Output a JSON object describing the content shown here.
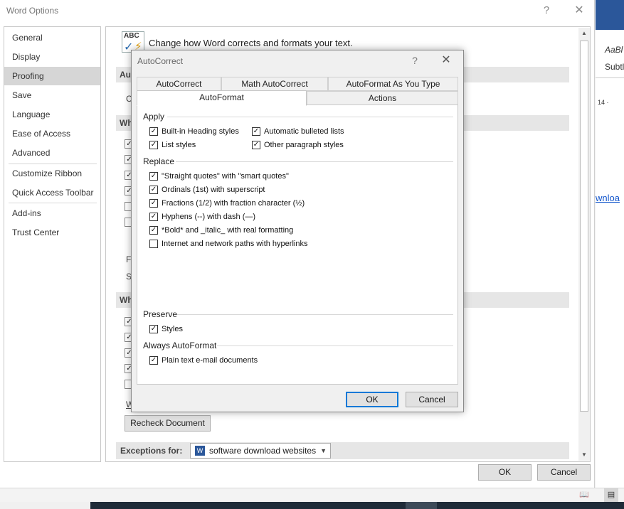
{
  "word_options": {
    "title": "Word Options",
    "help_glyph": "?",
    "close_glyph": "✕",
    "nav": [
      {
        "label": "General"
      },
      {
        "label": "Display"
      },
      {
        "label": "Proofing",
        "selected": true
      },
      {
        "label": "Save"
      },
      {
        "label": "Language"
      },
      {
        "label": "Ease of Access"
      },
      {
        "label": "Advanced"
      },
      {
        "label": "Customize Ribbon"
      },
      {
        "label": "Quick Access Toolbar"
      },
      {
        "label": "Add-ins"
      },
      {
        "label": "Trust Center"
      }
    ],
    "proofing_heading": "Change how Word corrects and formats your text.",
    "icon_label": "ABC",
    "partial_texts": [
      "Aut",
      "C",
      "Wh",
      "Fr",
      "Sp",
      "Wh",
      "W"
    ],
    "recheck_label": "Recheck Document",
    "exceptions_label": "Exceptions for:",
    "exceptions_value": "software download websites",
    "ok_label": "OK",
    "cancel_label": "Cancel"
  },
  "background_word": {
    "style1": "AaBl",
    "style2": "Subtl",
    "ruler_number": "14 ·",
    "link_text": "wnloa"
  },
  "autocorrect_dialog": {
    "title": "AutoCorrect",
    "help_glyph": "?",
    "close_glyph": "✕",
    "tabs_row1": [
      "AutoCorrect",
      "Math AutoCorrect",
      "AutoFormat As You Type"
    ],
    "tabs_row2": [
      "AutoFormat",
      "Actions"
    ],
    "selected_tab": "AutoFormat",
    "groups": {
      "apply": {
        "label": "Apply",
        "items": [
          {
            "label": "Built-in Heading styles",
            "checked": true
          },
          {
            "label": "Automatic bulleted lists",
            "checked": true
          },
          {
            "label": "List styles",
            "checked": true
          },
          {
            "label": "Other paragraph styles",
            "checked": true
          }
        ]
      },
      "replace": {
        "label": "Replace",
        "items": [
          {
            "label": "\"Straight quotes\" with \"smart quotes\"",
            "checked": true
          },
          {
            "label": "Ordinals (1st) with superscript",
            "checked": true
          },
          {
            "label": "Fractions (1/2) with fraction character (½)",
            "checked": true
          },
          {
            "label": "Hyphens (--) with dash (—)",
            "checked": true
          },
          {
            "label": "*Bold* and _italic_ with real formatting",
            "checked": true
          },
          {
            "label": "Internet and network paths with hyperlinks",
            "checked": false
          }
        ]
      },
      "preserve": {
        "label": "Preserve",
        "items": [
          {
            "label": "Styles",
            "checked": true
          }
        ]
      },
      "always": {
        "label": "Always AutoFormat",
        "items": [
          {
            "label": "Plain text e-mail documents",
            "checked": true
          }
        ]
      }
    },
    "ok_label": "OK",
    "cancel_label": "Cancel"
  }
}
